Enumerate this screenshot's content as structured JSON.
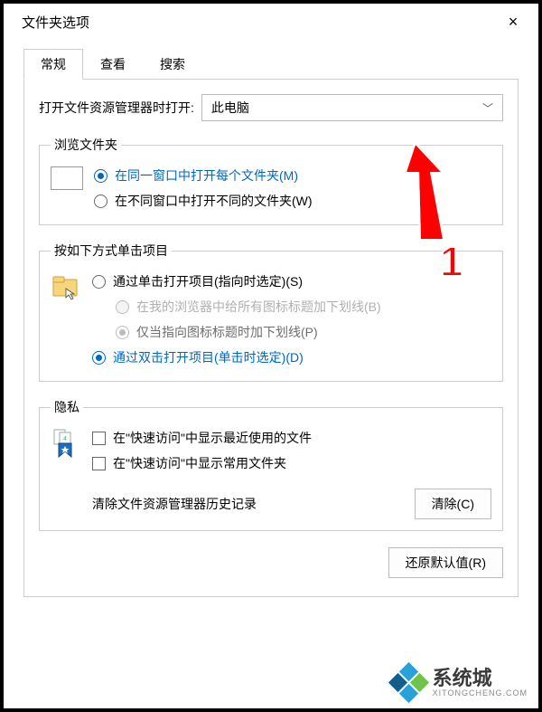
{
  "window": {
    "title": "文件夹选项",
    "close": "×"
  },
  "tabs": {
    "general": "常规",
    "view": "查看",
    "search": "搜索"
  },
  "open_with": {
    "label": "打开文件资源管理器时打开:",
    "value": "此电脑"
  },
  "browse": {
    "legend": "浏览文件夹",
    "opt_same": "在同一窗口中打开每个文件夹(M)",
    "opt_diff": "在不同窗口中打开不同的文件夹(W)"
  },
  "click": {
    "legend": "按如下方式单击项目",
    "opt_single": "通过单击打开项目(指向时选定)(S)",
    "opt_underline_all": "在我的浏览器中给所有图标标题加下划线(B)",
    "opt_underline_hover": "仅当指向图标标题时加下划线(P)",
    "opt_double": "通过双击打开项目(单击时选定)(D)"
  },
  "privacy": {
    "legend": "隐私",
    "chk_recent_files": "在\"快速访问\"中显示最近使用的文件",
    "chk_frequent_folders": "在\"快速访问\"中显示常用文件夹",
    "history_label": "清除文件资源管理器历史记录",
    "clear_btn": "清除(C)"
  },
  "restore_btn": "还原默认值(R)",
  "annotation": {
    "number": "1"
  },
  "watermark": {
    "name": "系统城",
    "url": "XITONGCHENG.COM"
  }
}
